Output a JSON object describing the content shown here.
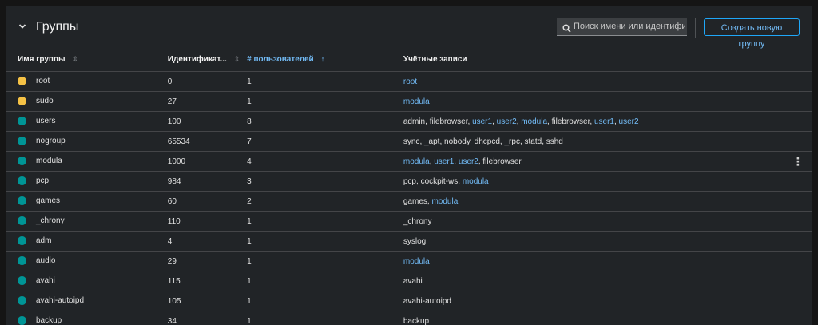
{
  "header": {
    "title": "Группы",
    "search_placeholder": "Поиск имени или идентифик...",
    "create_button": "Создать новую группу"
  },
  "columns": {
    "name": "Имя группы",
    "id": "Идентификат...",
    "users": "# пользователей",
    "accounts": "Учётные записи"
  },
  "colors": {
    "system_group": "#f4c145",
    "user_group": "#009596",
    "link": "#73bcf7"
  },
  "rows": [
    {
      "name": "root",
      "id": "0",
      "users": "1",
      "type": "system",
      "accounts": [
        {
          "text": "root",
          "link": true
        }
      ]
    },
    {
      "name": "sudo",
      "id": "27",
      "users": "1",
      "type": "system",
      "accounts": [
        {
          "text": "modula",
          "link": true
        }
      ]
    },
    {
      "name": "users",
      "id": "100",
      "users": "8",
      "type": "user",
      "accounts": [
        {
          "text": "admin",
          "link": false
        },
        {
          "text": "filebrowser",
          "link": false
        },
        {
          "text": "user1",
          "link": true
        },
        {
          "text": "user2",
          "link": true
        },
        {
          "text": "modula",
          "link": true
        },
        {
          "text": "filebrowser",
          "link": false
        },
        {
          "text": "user1",
          "link": true
        },
        {
          "text": "user2",
          "link": true
        }
      ]
    },
    {
      "name": "nogroup",
      "id": "65534",
      "users": "7",
      "type": "user",
      "accounts": [
        {
          "text": "sync",
          "link": false
        },
        {
          "text": "_apt",
          "link": false
        },
        {
          "text": "nobody",
          "link": false
        },
        {
          "text": "dhcpcd",
          "link": false
        },
        {
          "text": "_rpc",
          "link": false
        },
        {
          "text": "statd",
          "link": false
        },
        {
          "text": "sshd",
          "link": false
        }
      ]
    },
    {
      "name": "modula",
      "id": "1000",
      "users": "4",
      "type": "user",
      "kebab": true,
      "accounts": [
        {
          "text": "modula",
          "link": true
        },
        {
          "text": "user1",
          "link": true
        },
        {
          "text": "user2",
          "link": true
        },
        {
          "text": "filebrowser",
          "link": false
        }
      ]
    },
    {
      "name": "pcp",
      "id": "984",
      "users": "3",
      "type": "user",
      "accounts": [
        {
          "text": "pcp",
          "link": false
        },
        {
          "text": "cockpit-ws",
          "link": false
        },
        {
          "text": "modula",
          "link": true
        }
      ]
    },
    {
      "name": "games",
      "id": "60",
      "users": "2",
      "type": "user",
      "accounts": [
        {
          "text": "games",
          "link": false
        },
        {
          "text": "modula",
          "link": true
        }
      ]
    },
    {
      "name": "_chrony",
      "id": "110",
      "users": "1",
      "type": "user",
      "accounts": [
        {
          "text": "_chrony",
          "link": false
        }
      ]
    },
    {
      "name": "adm",
      "id": "4",
      "users": "1",
      "type": "user",
      "accounts": [
        {
          "text": "syslog",
          "link": false
        }
      ]
    },
    {
      "name": "audio",
      "id": "29",
      "users": "1",
      "type": "user",
      "accounts": [
        {
          "text": "modula",
          "link": true
        }
      ]
    },
    {
      "name": "avahi",
      "id": "115",
      "users": "1",
      "type": "user",
      "accounts": [
        {
          "text": "avahi",
          "link": false
        }
      ]
    },
    {
      "name": "avahi-autoipd",
      "id": "105",
      "users": "1",
      "type": "user",
      "accounts": [
        {
          "text": "avahi-autoipd",
          "link": false
        }
      ]
    },
    {
      "name": "backup",
      "id": "34",
      "users": "1",
      "type": "user",
      "accounts": [
        {
          "text": "backup",
          "link": false
        }
      ]
    }
  ]
}
